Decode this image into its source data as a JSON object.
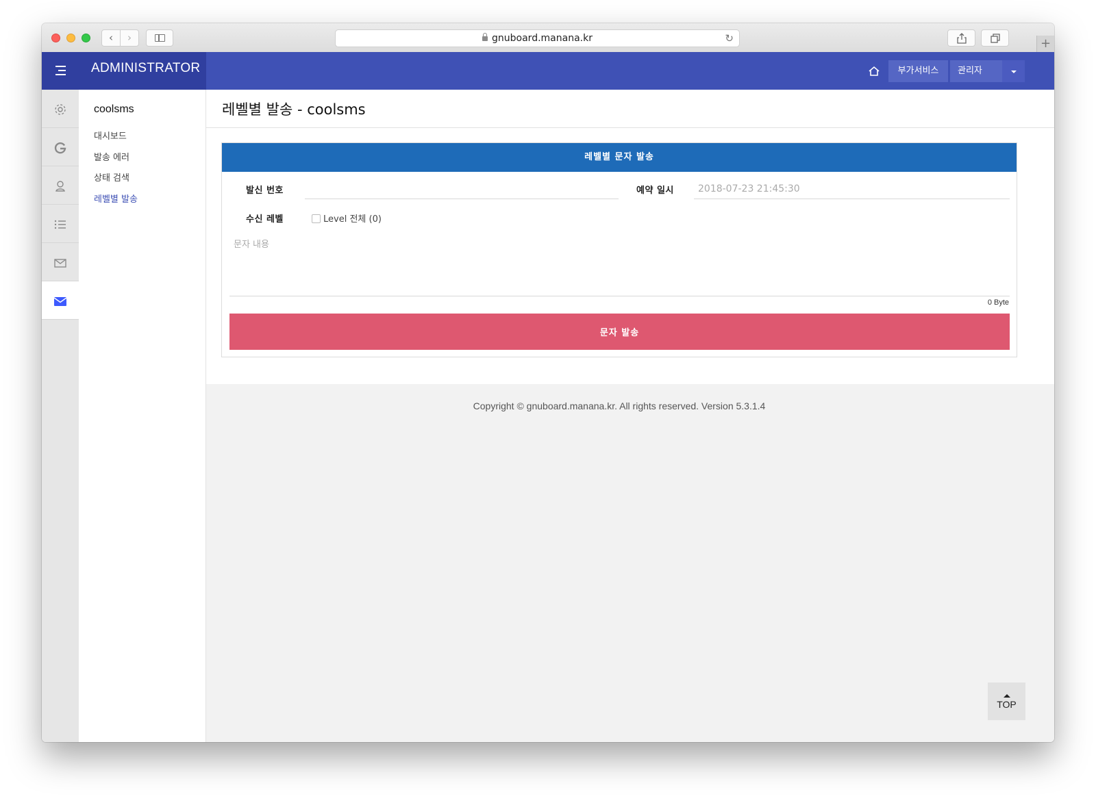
{
  "browser": {
    "url": "gnuboard.manana.kr"
  },
  "header": {
    "brand": "ADMINISTRATOR",
    "addon_label": "부가서비스",
    "admin_label": "관리자",
    "accent": "#3f51b5"
  },
  "rail": {
    "icons": [
      "gear-icon",
      "google-icon",
      "user-icon",
      "list-icon",
      "mail-outline-icon",
      "mail-icon"
    ],
    "active_index": 5
  },
  "submenu": {
    "title": "coolsms",
    "items": [
      {
        "label": "대시보드"
      },
      {
        "label": "발송 에러"
      },
      {
        "label": "상태 검색"
      },
      {
        "label": "레벨별 발송",
        "active": true
      }
    ]
  },
  "main": {
    "page_title": "레벨별 발송 - coolsms",
    "panel": {
      "title": "레벨별 문자 발송",
      "sender_label": "발신 번호",
      "sender_value": "",
      "reserve_label": "예약 일시",
      "reserve_placeholder": "2018-07-23 21:45:30",
      "level_label": "수신 레벨",
      "level_all_label": "Level 전체 (0)",
      "level_all_checked": false,
      "message_placeholder": "문자 내용",
      "byte_count": "0 Byte",
      "send_label": "문자 발송",
      "header_color": "#1e6bb8",
      "send_color": "#de5870"
    },
    "copyright": "Copyright © gnuboard.manana.kr. All rights reserved. Version 5.3.1.4",
    "top_label": "TOP"
  }
}
